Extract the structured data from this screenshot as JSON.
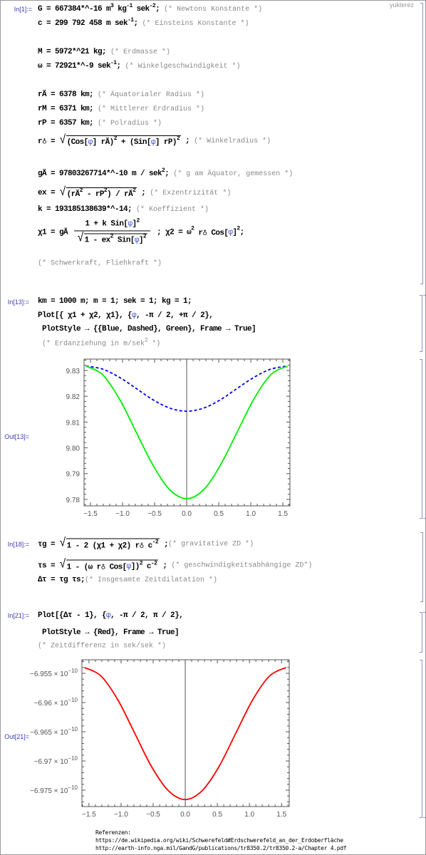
{
  "watermark": "yukterez",
  "cells": [
    {
      "in_label": "In[1]:=",
      "lines": [
        [
          {
            "t": "G = 667384*^-16 m"
          },
          {
            "sup": "3"
          },
          {
            "t": " kg"
          },
          {
            "sup": "-1"
          },
          {
            "t": " sek"
          },
          {
            "sup": "-2"
          },
          {
            "t": "; "
          },
          {
            "c": "(* Newtons Konstante *)"
          }
        ],
        [
          {
            "t": "c = 299 792 458 m sek"
          },
          {
            "sup": "-1"
          },
          {
            "t": "; "
          },
          {
            "c": "(* Einsteins Konstante *)"
          }
        ],
        [
          {
            "t": "M = 5972*^21 kg; "
          },
          {
            "c": "(* Erdmasse *)"
          }
        ],
        [
          {
            "t": "ω = 72921*^-9 sek"
          },
          {
            "sup": "-1"
          },
          {
            "t": "; "
          },
          {
            "c": "(* Winkelgeschwindigkeit *)"
          }
        ],
        [
          {
            "t": "rÄ = 6378 km; "
          },
          {
            "c": "(* Äquatorialer Radius *)"
          }
        ],
        [
          {
            "t": "rM = 6371 km; "
          },
          {
            "c": "(* Mittlerer Erdradius *)"
          }
        ],
        [
          {
            "t": "rP = 6357 km; "
          },
          {
            "c": "(* Polradius *)"
          }
        ],
        [
          {
            "t": "r♁ = "
          },
          {
            "sqrt": [
              {
                "t": "(Cos["
              },
              {
                "v": "φ"
              },
              {
                "t": "] rÄ)"
              },
              {
                "sup": "2"
              },
              {
                "t": " + (Sin["
              },
              {
                "v": "φ"
              },
              {
                "t": "] rP)"
              },
              {
                "sup": "2"
              }
            ]
          },
          {
            "t": " ; "
          },
          {
            "c": "(* Winkelradius *)"
          }
        ],
        [
          {
            "t": "gÄ = 97803267714*^-10 m / sek"
          },
          {
            "sup": "2"
          },
          {
            "t": "; "
          },
          {
            "c": "(* g am Äquator, gemessen *)"
          }
        ],
        [
          {
            "t": "ex = "
          },
          {
            "sqrt": [
              {
                "t": "(rÄ"
              },
              {
                "sup": "2"
              },
              {
                "t": " - rP"
              },
              {
                "sup": "2"
              },
              {
                "t": ") / rÄ"
              },
              {
                "sup": "2"
              }
            ]
          },
          {
            "t": " ; "
          },
          {
            "c": "(* Exzentrizität *)"
          }
        ],
        [
          {
            "t": "k = 193185138639*^-14; "
          },
          {
            "c": "(* Koeffizient *)"
          }
        ],
        [
          {
            "t": "χ1 = gÄ "
          },
          {
            "frac": {
              "num": [
                {
                  "t": "1 + k Sin["
                },
                {
                  "v": "φ"
                },
                {
                  "t": "]"
                },
                {
                  "sup": "2"
                }
              ],
              "den": [
                {
                  "sqrt": [
                    {
                      "t": "1 - ex"
                    },
                    {
                      "sup": "2"
                    },
                    {
                      "t": " Sin["
                    },
                    {
                      "v": "φ"
                    },
                    {
                      "t": "]"
                    },
                    {
                      "sup": "2"
                    }
                  ]
                }
              ]
            }
          },
          {
            "t": " ; χ2 = ω"
          },
          {
            "sup": "2"
          },
          {
            "t": " r♁ Cos["
          },
          {
            "v": "φ"
          },
          {
            "t": "]"
          },
          {
            "sup": "2"
          },
          {
            "t": ";"
          }
        ],
        [
          {
            "c": "(* Schwerkraft, Fliehkraft *)"
          }
        ]
      ]
    },
    {
      "in_label": "In[13]:=",
      "out_label": "Out[13]=",
      "lines": [
        [
          {
            "t": "km = 1000 m; m = 1; sek = 1; kg = 1;"
          }
        ],
        [
          {
            "t": "Plot[{ χ1 + χ2, χ1}, {"
          },
          {
            "v": "φ"
          },
          {
            "t": ", -π / 2, +π / 2},"
          }
        ],
        [
          {
            "t": " PlotStyle → {{Blue, Dashed}, Green}, Frame → True]"
          }
        ],
        [
          {
            "c": " (* Erdanziehung in m/sek"
          },
          {
            "csup": "2"
          },
          {
            "c": " *)"
          }
        ]
      ]
    },
    {
      "in_label": "In[18]:=",
      "lines": [
        [
          {
            "t": "τg = "
          },
          {
            "sqrt": [
              {
                "t": "1 - 2 (χ1 + χ2) r♁ c"
              },
              {
                "sup": "-2"
              }
            ]
          },
          {
            "t": " ;"
          },
          {
            "c": "(* gravitative ZD *)"
          }
        ],
        [
          {
            "t": "τs = "
          },
          {
            "sqrt": [
              {
                "t": "1 - (ω r♁ Cos["
              },
              {
                "v": "φ"
              },
              {
                "t": "])"
              },
              {
                "sup": "2"
              },
              {
                "t": " c"
              },
              {
                "sup": "-2"
              }
            ]
          },
          {
            "t": " ; "
          },
          {
            "c": "(* geschwindigkeitsabhängige ZD*)"
          }
        ],
        [
          {
            "t": "Δτ = τg τs;"
          },
          {
            "c": "(* Insgesamte Zeitdilatation *)"
          }
        ]
      ]
    },
    {
      "in_label": "In[21]:=",
      "out_label": "Out[21]=",
      "lines": [
        [
          {
            "t": "Plot[{Δτ - 1}, {"
          },
          {
            "v": "φ"
          },
          {
            "t": ", -π / 2, π / 2},"
          }
        ],
        [
          {
            "t": " PlotStyle → {Red}, Frame → True]"
          }
        ],
        [
          {
            "c": "(* Zeitdifferenz in sek/sek *)"
          }
        ]
      ]
    }
  ],
  "references": {
    "title": "Referenzen:",
    "links": [
      "https://de.wikipedia.org/wiki/Schwerefeld#Erdschwerefeld_an_der_Erdoberfläche",
      "http://earth-info.nga.mil/GandG/publications/tr8350.2/tr8350.2-a/Chapter 4.pdf"
    ]
  },
  "chart_data": [
    {
      "type": "line",
      "frame": true,
      "grid": false,
      "xlim": [
        -1.6,
        1.61
      ],
      "ylim": [
        9.7775,
        9.8344
      ],
      "xticks": [
        -1.5,
        -1.0,
        -0.5,
        0.0,
        0.5,
        1.0,
        1.5
      ],
      "xtick_labels": [
        "−1.5",
        "−1.0",
        "−0.5",
        "0.0",
        "0.5",
        "1.0",
        "1.5"
      ],
      "yticks": [
        9.78,
        9.79,
        9.8,
        9.81,
        9.82,
        9.83
      ],
      "ytick_labels": [
        "9.78",
        "9.79",
        "9.80",
        "9.81",
        "9.82",
        "9.83"
      ],
      "x": [
        -1.5708,
        -1.309,
        -1.0472,
        -0.7854,
        -0.5236,
        -0.2618,
        0,
        0.2618,
        0.5236,
        0.7854,
        1.0472,
        1.309,
        1.5708
      ],
      "series": [
        {
          "color": "#0000ff",
          "style": "dashed",
          "values": [
            9.8317,
            9.8305,
            9.8273,
            9.823,
            9.8186,
            9.8154,
            9.8142,
            9.8154,
            9.8186,
            9.823,
            9.8273,
            9.8305,
            9.8317
          ]
        },
        {
          "color": "#00ee00",
          "style": "solid",
          "values": [
            9.8317,
            9.8283,
            9.8189,
            9.806,
            9.7932,
            9.7837,
            9.7803,
            9.7837,
            9.7932,
            9.806,
            9.8189,
            9.8283,
            9.8317
          ]
        }
      ]
    },
    {
      "type": "line",
      "frame": true,
      "grid": false,
      "xlim": [
        -1.61,
        1.62
      ],
      "ylim": [
        -6.95268e-10,
        -6.9778e-10
      ],
      "xticks": [
        -1.5,
        -1.0,
        -0.5,
        0.0,
        0.5,
        1.0,
        1.5
      ],
      "xtick_labels": [
        "−1.5",
        "−1.0",
        "−0.5",
        "0.0",
        "0.5",
        "1.0",
        "1.5"
      ],
      "yticks": [
        -6.955e-10,
        -6.96e-10,
        -6.965e-10,
        -6.97e-10,
        -6.975e-10
      ],
      "ytick_labels": [
        {
          "mant": "−6.955 × 10",
          "exp": "−10"
        },
        {
          "mant": "−6.96 × 10",
          "exp": "−10"
        },
        {
          "mant": "−6.965 × 10",
          "exp": "−10"
        },
        {
          "mant": "−6.97 × 10",
          "exp": "−10"
        },
        {
          "mant": "−6.975 × 10",
          "exp": "−10"
        }
      ],
      "x": [
        -1.5708,
        -1.309,
        -1.0472,
        -0.7854,
        -0.5236,
        -0.2618,
        0,
        0.2618,
        0.5236,
        0.7854,
        1.0472,
        1.309,
        1.5708
      ],
      "series": [
        {
          "color": "#ff0000",
          "style": "solid",
          "values": [
            -6.954e-10,
            -6.9555e-10,
            -6.9596e-10,
            -6.9653e-10,
            -6.971e-10,
            -6.9751e-10,
            -6.9766e-10,
            -6.9751e-10,
            -6.971e-10,
            -6.9653e-10,
            -6.9596e-10,
            -6.9555e-10,
            -6.954e-10
          ]
        }
      ]
    }
  ]
}
